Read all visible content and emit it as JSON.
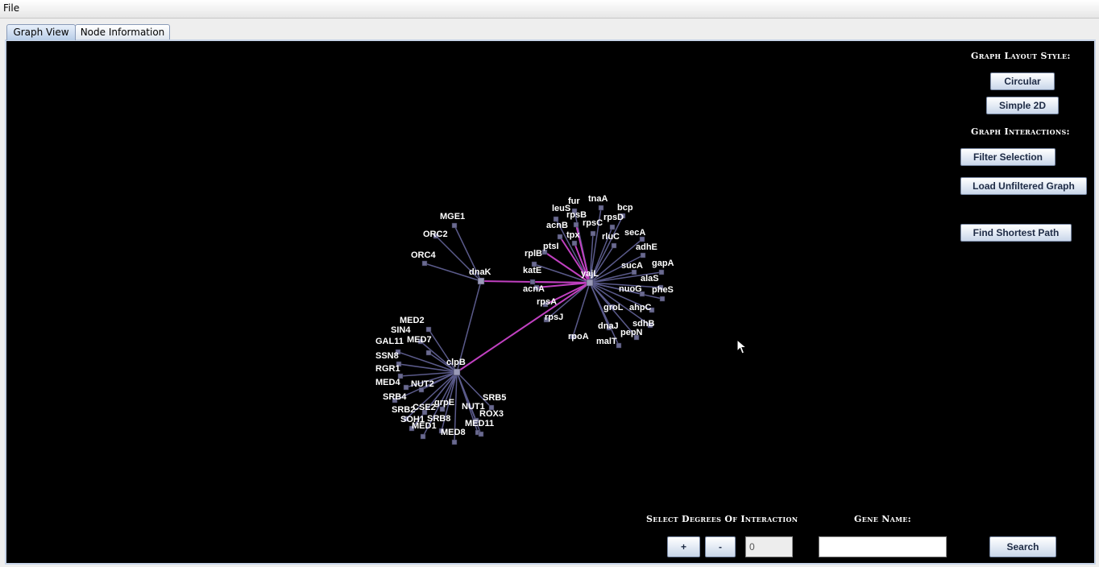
{
  "menu": {
    "file_label": "File"
  },
  "tabs": [
    {
      "label": "Graph View",
      "active": true
    },
    {
      "label": "Node Information",
      "active": false
    }
  ],
  "sidebar": {
    "layout_title": "Graph Layout Style:",
    "circular_label": "Circular",
    "simple2d_label": "Simple 2D",
    "interactions_title": "Graph Interactions:",
    "filter_label": "Filter Selection",
    "load_unfiltered_label": "Load Unfiltered Graph",
    "shortest_path_label": "Find Shortest Path"
  },
  "bottom": {
    "degrees_title": "Select Degrees Of Interaction",
    "gene_title": "Gene Name:",
    "plus_label": "+",
    "minus_label": "-",
    "degree_value": "0",
    "gene_value": "",
    "search_label": "Search"
  },
  "colors": {
    "background": "#000000",
    "edge": "#5a5a8a",
    "highlight_edge": "#c040c0",
    "node": "#6a6a90",
    "label": "#ffffff"
  },
  "graph": {
    "hubs": [
      "yajL",
      "clpB",
      "dnaK"
    ],
    "labels": [
      "MGE1",
      "ORC2",
      "ORC4",
      "dnaK",
      "fur",
      "tnaA",
      "leuS",
      "bcp",
      "rpsB",
      "rpsD",
      "rpsC",
      "acnB",
      "rluC",
      "secA",
      "tpx",
      "ptsI",
      "adhE",
      "rplB",
      "sucA",
      "gapA",
      "katE",
      "yajL",
      "alaS",
      "acnA",
      "nuoG",
      "pheS",
      "rpsA",
      "groL",
      "ahpC",
      "rpsJ",
      "sdhB",
      "dnaJ",
      "pepN",
      "rpoA",
      "malT",
      "MED2",
      "SIN4",
      "MED7",
      "GAL11",
      "SSN8",
      "clpB",
      "RGR1",
      "MED4",
      "NUT2",
      "SRB4",
      "SRB5",
      "grpE",
      "CSE2",
      "SRB2",
      "NUT1",
      "SOH1",
      "SRB8",
      "ROX3",
      "MED1",
      "MED11",
      "MED8"
    ],
    "edges": [
      [
        "yajL",
        "fur"
      ],
      [
        "yajL",
        "tnaA"
      ],
      [
        "yajL",
        "leuS"
      ],
      [
        "yajL",
        "bcp"
      ],
      [
        "yajL",
        "rpsB"
      ],
      [
        "yajL",
        "rpsD"
      ],
      [
        "yajL",
        "rpsC"
      ],
      [
        "yajL",
        "acnB"
      ],
      [
        "yajL",
        "rluC"
      ],
      [
        "yajL",
        "secA"
      ],
      [
        "yajL",
        "tpx"
      ],
      [
        "yajL",
        "ptsI"
      ],
      [
        "yajL",
        "adhE"
      ],
      [
        "yajL",
        "rplB"
      ],
      [
        "yajL",
        "sucA"
      ],
      [
        "yajL",
        "gapA"
      ],
      [
        "yajL",
        "katE"
      ],
      [
        "yajL",
        "alaS"
      ],
      [
        "yajL",
        "acnA"
      ],
      [
        "yajL",
        "nuoG"
      ],
      [
        "yajL",
        "pheS"
      ],
      [
        "yajL",
        "rpsA"
      ],
      [
        "yajL",
        "groL"
      ],
      [
        "yajL",
        "ahpC"
      ],
      [
        "yajL",
        "rpsJ"
      ],
      [
        "yajL",
        "sdhB"
      ],
      [
        "yajL",
        "dnaJ"
      ],
      [
        "yajL",
        "pepN"
      ],
      [
        "yajL",
        "rpoA"
      ],
      [
        "yajL",
        "malT"
      ],
      [
        "dnaK",
        "MGE1"
      ],
      [
        "dnaK",
        "ORC2"
      ],
      [
        "dnaK",
        "ORC4"
      ],
      [
        "dnaK",
        "yajL"
      ],
      [
        "dnaK",
        "clpB"
      ],
      [
        "clpB",
        "yajL"
      ],
      [
        "clpB",
        "MED2"
      ],
      [
        "clpB",
        "SIN4"
      ],
      [
        "clpB",
        "MED7"
      ],
      [
        "clpB",
        "GAL11"
      ],
      [
        "clpB",
        "SSN8"
      ],
      [
        "clpB",
        "RGR1"
      ],
      [
        "clpB",
        "MED4"
      ],
      [
        "clpB",
        "NUT2"
      ],
      [
        "clpB",
        "SRB4"
      ],
      [
        "clpB",
        "SRB5"
      ],
      [
        "clpB",
        "grpE"
      ],
      [
        "clpB",
        "CSE2"
      ],
      [
        "clpB",
        "SRB2"
      ],
      [
        "clpB",
        "NUT1"
      ],
      [
        "clpB",
        "SOH1"
      ],
      [
        "clpB",
        "SRB8"
      ],
      [
        "clpB",
        "ROX3"
      ],
      [
        "clpB",
        "MED1"
      ],
      [
        "clpB",
        "MED11"
      ],
      [
        "clpB",
        "MED8"
      ]
    ],
    "highlighted_edges": [
      [
        "yajL",
        "dnaK"
      ],
      [
        "yajL",
        "clpB"
      ],
      [
        "yajL",
        "acnB"
      ],
      [
        "yajL",
        "rpsB"
      ],
      [
        "yajL",
        "tpx"
      ],
      [
        "yajL",
        "ptsI"
      ],
      [
        "yajL",
        "katE"
      ],
      [
        "yajL",
        "acnA"
      ],
      [
        "yajL",
        "rpsA"
      ]
    ]
  }
}
